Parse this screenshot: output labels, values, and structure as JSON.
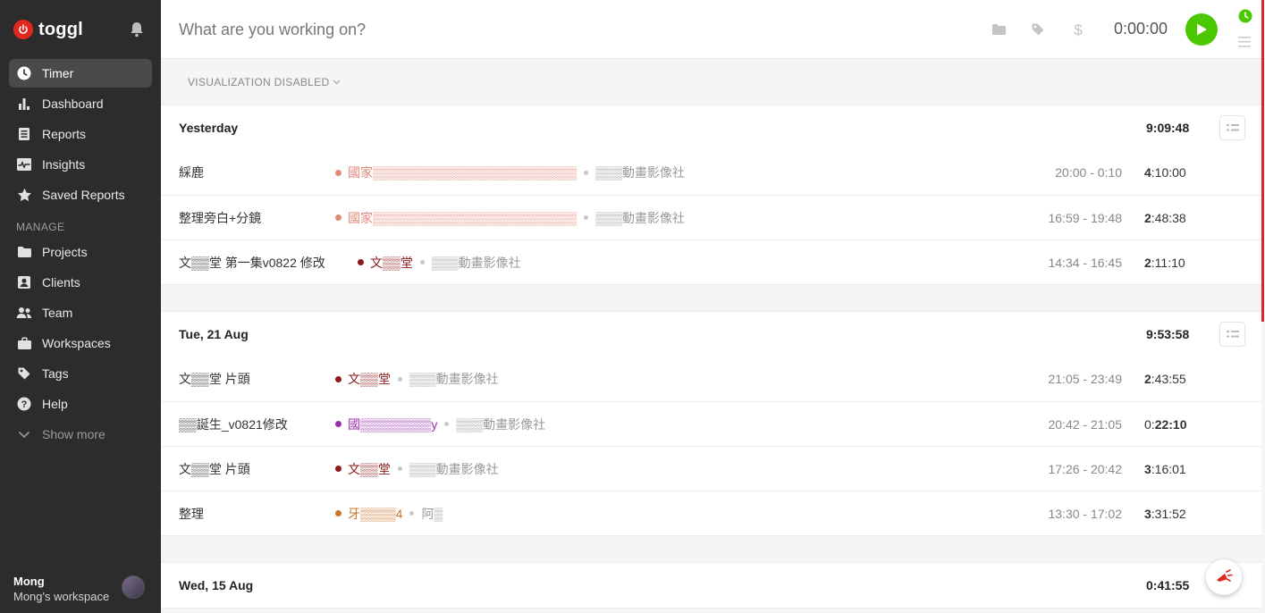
{
  "brand": {
    "name": "toggl"
  },
  "sidebar": {
    "items": [
      {
        "label": "Timer",
        "icon": "clock-icon",
        "active": true
      },
      {
        "label": "Dashboard",
        "icon": "bar-chart-icon"
      },
      {
        "label": "Reports",
        "icon": "document-icon"
      },
      {
        "label": "Insights",
        "icon": "pulse-icon"
      },
      {
        "label": "Saved Reports",
        "icon": "star-icon"
      }
    ],
    "manage_label": "MANAGE",
    "manage_items": [
      {
        "label": "Projects",
        "icon": "folder-icon"
      },
      {
        "label": "Clients",
        "icon": "contact-icon"
      },
      {
        "label": "Team",
        "icon": "people-icon"
      },
      {
        "label": "Workspaces",
        "icon": "briefcase-icon"
      },
      {
        "label": "Tags",
        "icon": "tag-icon"
      },
      {
        "label": "Help",
        "icon": "help-icon"
      }
    ],
    "show_more": "Show more",
    "user": {
      "name": "Mong",
      "workspace": "Mong's workspace"
    }
  },
  "timer": {
    "placeholder": "What are you working on?",
    "display": "0:00:00"
  },
  "list": {
    "visualization_label": "VISUALIZATION DISABLED",
    "groups": [
      {
        "date": "Yesterday",
        "total": "9:09:48",
        "entries": [
          {
            "desc": "綵鹿",
            "project": "國家▒▒▒▒▒▒▒▒▒▒▒▒▒▒▒▒▒▒▒▒▒▒▒",
            "client": "▒▒▒動畫影像社",
            "range": "20:00 - 0:10",
            "dur_h": "4",
            "dur_rest": ":10:00"
          },
          {
            "desc": "整理旁白+分鏡",
            "project": "國家▒▒▒▒▒▒▒▒▒▒▒▒▒▒▒▒▒▒▒▒▒▒▒",
            "client": "▒▒▒動畫影像社",
            "range": "16:59 - 19:48",
            "dur_h": "2",
            "dur_rest": ":48:38"
          },
          {
            "desc": "文▒▒堂 第一集v0822 修改",
            "project": "文▒▒堂",
            "client": "▒▒▒動畫影像社",
            "range": "14:34 - 16:45",
            "dur_h": "2",
            "dur_rest": ":11:10"
          }
        ]
      },
      {
        "date": "Tue, 21 Aug",
        "total": "9:53:58",
        "entries": [
          {
            "desc": "文▒▒堂 片頭",
            "project": "文▒▒堂",
            "client": "▒▒▒動畫影像社",
            "range": "21:05 - 23:49",
            "dur_h": "2",
            "dur_rest": ":43:55"
          },
          {
            "desc": "▒▒誕生_v0821修改",
            "project": "國▒▒▒▒▒▒▒▒y",
            "client": "▒▒▒動畫影像社",
            "range": "20:42 - 21:05",
            "dur_h": "0:",
            "dur_rest": "22:10"
          },
          {
            "desc": "文▒▒堂 片頭",
            "project": "文▒▒堂",
            "client": "▒▒▒動畫影像社",
            "range": "17:26 - 20:42",
            "dur_h": "3",
            "dur_rest": ":16:01"
          },
          {
            "desc": "整理",
            "project": "牙▒▒▒▒4",
            "client": "阿▒",
            "range": "13:30 - 17:02",
            "dur_h": "3",
            "dur_rest": ":31:52"
          }
        ]
      },
      {
        "date": "Wed, 15 Aug",
        "total": "0:41:55",
        "entries": []
      }
    ]
  },
  "colors": {
    "accent": "#e2271e",
    "play": "#4bc800",
    "project_salmon": "#e08a7a",
    "project_maroon": "#8b1a1a",
    "project_purple": "#9b2fae",
    "project_orange": "#c9752a"
  }
}
